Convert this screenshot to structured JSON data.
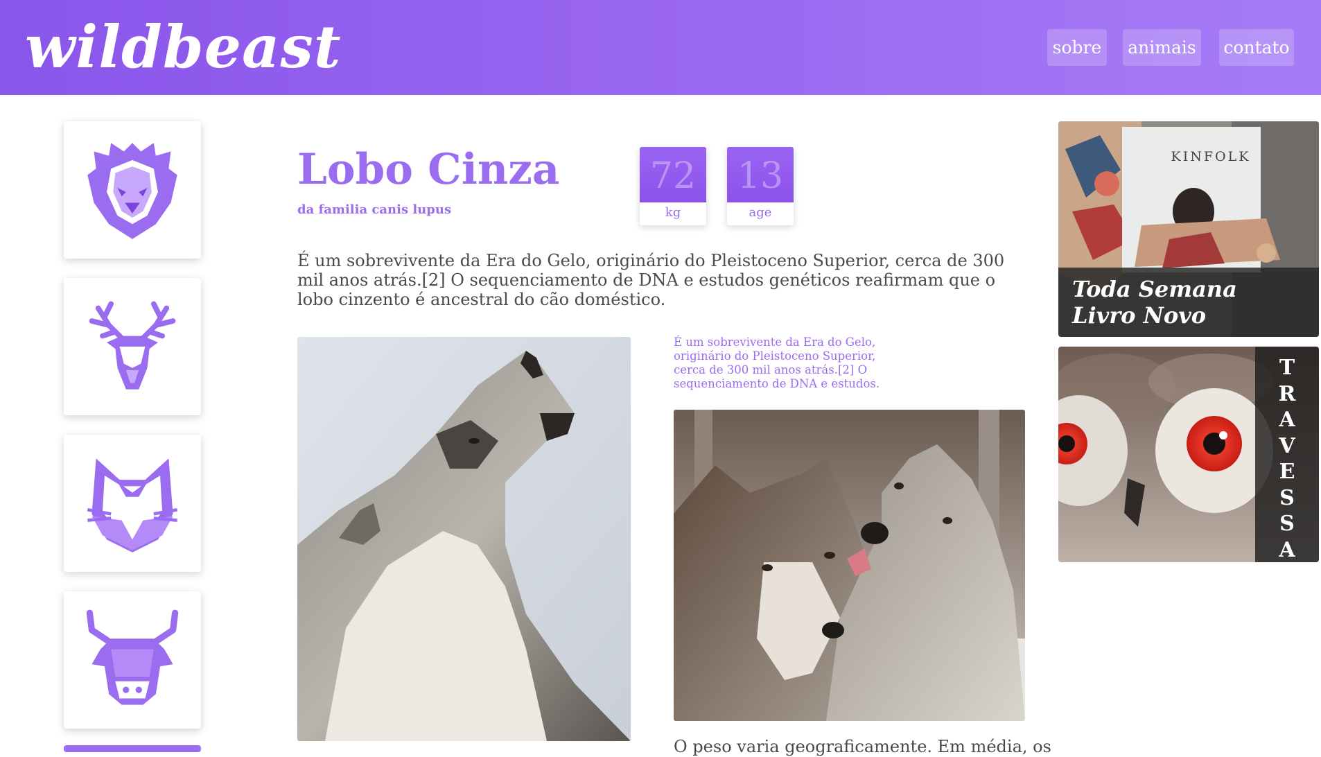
{
  "header": {
    "logo": "wildbeast",
    "nav": [
      {
        "label": "sobre"
      },
      {
        "label": "animais"
      },
      {
        "label": "contato"
      }
    ]
  },
  "sidebar": {
    "items": [
      {
        "icon": "lion-icon"
      },
      {
        "icon": "deer-icon"
      },
      {
        "icon": "fox-icon"
      },
      {
        "icon": "bull-icon"
      }
    ],
    "accent": "#9a6cf0"
  },
  "animal": {
    "name": "Lobo Cinza",
    "family": "da familia canis lupus",
    "stats": [
      {
        "value": "72",
        "label": "kg"
      },
      {
        "value": "13",
        "label": "age"
      }
    ],
    "description": "É um sobrevivente da Era do Gelo, originário do Pleistoceno Superior, cerca de 300 mil anos atrás.[2] O sequenciamento de DNA e estudos genéticos reafirmam que o lobo cinzento é ancestral do cão doméstico.",
    "quote": "É um sobrevivente da Era do Gelo, originário do Pleistoceno Superior, cerca de 300 mil anos atrás.[2] O sequenciamento de DNA e estudos.",
    "more_text": "O peso varia geograficamente. Em média, os"
  },
  "ads": {
    "kinfolk": {
      "brand": "KINFOLK",
      "caption_line1": "Toda Semana",
      "caption_line2": "Livro Novo"
    },
    "owl": {
      "word": "TRAVESSA"
    }
  },
  "colors": {
    "primary": "#8a55ea",
    "accent_text": "#9a6cf0",
    "body_text": "#4a4a4a"
  }
}
